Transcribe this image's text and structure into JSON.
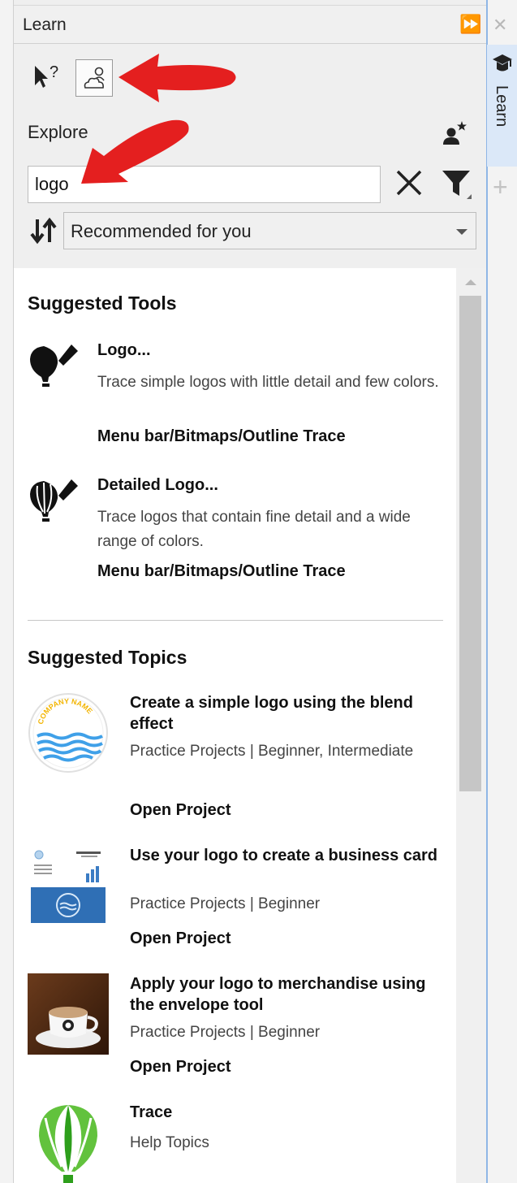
{
  "panel": {
    "title": "Learn",
    "explore_label": "Explore",
    "search": {
      "value": "logo"
    },
    "sort": {
      "selected": "Recommended for you"
    }
  },
  "right_tab": {
    "label": "Learn"
  },
  "suggested_tools": {
    "heading": "Suggested Tools",
    "items": [
      {
        "name": "Logo...",
        "description": "Trace simple logos with little detail and few colors.",
        "path": "Menu bar/Bitmaps/Outline Trace",
        "icon": "logo-trace-icon"
      },
      {
        "name": "Detailed Logo...",
        "description": "Trace logos that contain fine detail and a wide range of colors.",
        "path": "Menu bar/Bitmaps/Outline Trace",
        "icon": "detailed-logo-trace-icon"
      }
    ]
  },
  "suggested_topics": {
    "heading": "Suggested Topics",
    "items": [
      {
        "title": "Create a simple logo using the blend effect",
        "meta": "Practice Projects | Beginner, Intermediate",
        "action": "Open Project",
        "thumb_text": "COMPANY NAME"
      },
      {
        "title": "Use your logo to create a business card",
        "meta": "Practice Projects | Beginner",
        "action": "Open Project"
      },
      {
        "title": "Apply your logo to merchandise using the envelope tool",
        "meta": "Practice Projects | Beginner",
        "action": "Open Project"
      },
      {
        "title": "Trace",
        "meta": "Help Topics",
        "action": ""
      }
    ]
  },
  "colors": {
    "arrow": "#e41f1f",
    "tab_accent": "#8fb6e6"
  }
}
